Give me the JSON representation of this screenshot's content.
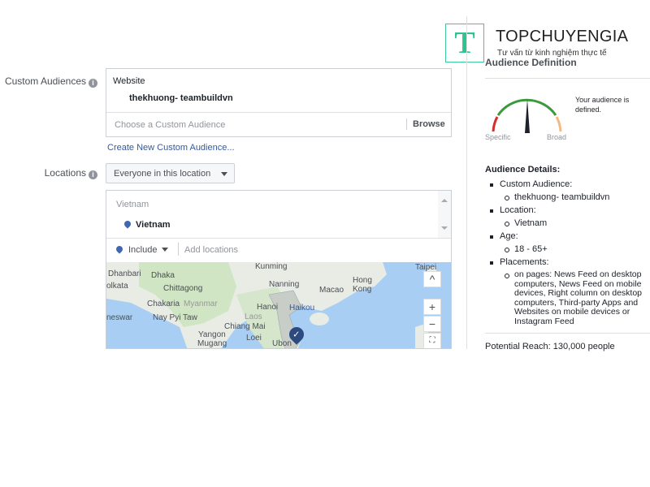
{
  "watermark": {
    "logo_letter": "T",
    "brand": "TOPCHUYENGIA",
    "tagline": "Tư vấn từ kinh nghiệm thực tế"
  },
  "custom_audiences": {
    "label": "Custom Audiences",
    "section": "Website",
    "selected": "thekhuong- teambuildvn",
    "placeholder": "Choose a Custom Audience",
    "browse": "Browse",
    "create_link": "Create New Custom Audience..."
  },
  "locations": {
    "label": "Locations",
    "dropdown": "Everyone in this location",
    "group": "Vietnam",
    "selected": "Vietnam",
    "include": "Include",
    "add_placeholder": "Add locations"
  },
  "map": {
    "labels": [
      "Kunming",
      "Taipei",
      "Dhanbari",
      "Dhaka",
      "Hong",
      "Kong",
      "olkata",
      "Chittagong",
      "Nanning",
      "Macao",
      "Chakaria",
      "Myanmar",
      "Hanoi",
      "Haikou",
      "neswar",
      "Nay Pyi Taw",
      "Laos",
      "Chiang Mai",
      "Yangon",
      "Loei",
      "Ubon",
      "Mugang"
    ],
    "zoom_in": "+",
    "zoom_out": "−",
    "collapse": "^"
  },
  "audience_definition": {
    "title": "Audience Definition",
    "status": "Your audience is defined.",
    "specific": "Specific",
    "broad": "Broad",
    "gauge_level": 0.5,
    "details_title": "Audience Details:",
    "details": [
      {
        "label": "Custom Audience:",
        "values": [
          "thekhuong- teambuildvn"
        ]
      },
      {
        "label": "Location:",
        "values": [
          "Vietnam"
        ]
      },
      {
        "label": "Age:",
        "values": [
          "18 - 65+"
        ]
      },
      {
        "label": "Placements:",
        "values": [
          "on pages: News Feed on desktop computers, News Feed on mobile devices, Right column on desktop computers, Third-party Apps and Websites on mobile devices or Instagram Feed"
        ]
      }
    ],
    "potential_reach": "Potential Reach: 130,000 people"
  }
}
